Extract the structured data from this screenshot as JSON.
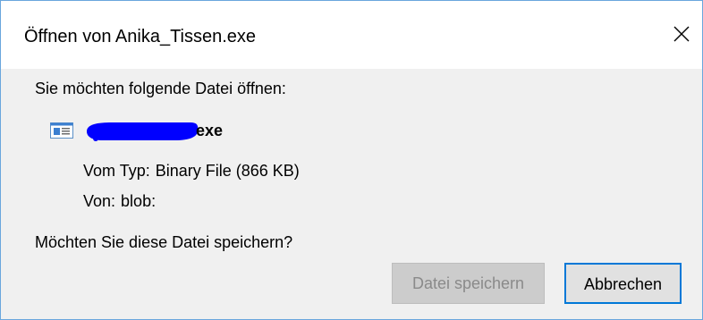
{
  "window": {
    "title": "Öffnen von Anika_Tissen.exe",
    "close_icon": "close-icon"
  },
  "dialog": {
    "prompt": "Sie möchten folgende Datei öffnen:",
    "file": {
      "icon": "executable-file-icon",
      "name_visible_suffix": "exe",
      "name_redacted": true,
      "redaction_color": "#0000ff"
    },
    "type_label": "Vom Typ:",
    "type_value": "Binary File (866 KB)",
    "from_label": "Von:",
    "from_value": "blob:",
    "question": "Möchten Sie diese Datei speichern?"
  },
  "buttons": {
    "save_label": "Datei speichern",
    "save_enabled": false,
    "cancel_label": "Abbrechen"
  },
  "colors": {
    "window_border": "#6aa6dd",
    "body_bg": "#f0f0f0",
    "accent": "#0078d7"
  }
}
